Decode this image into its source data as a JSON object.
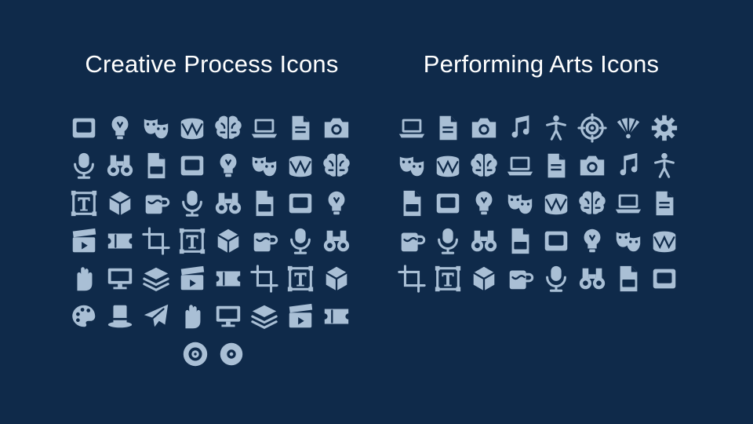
{
  "left_section": {
    "title": "Creative Process Icons"
  },
  "right_section": {
    "title": "Performing Arts Icons"
  },
  "theme": {
    "background": "#0f2a4a",
    "icon_color": "#a9bfd5",
    "title_color": "#ffffff"
  },
  "left_icons": [
    [
      "compass-drawing-icon",
      "color-swatch-icon",
      "cubes-icon",
      "color-wheel-icon",
      "puzzle-icon",
      "eye-frame-icon",
      "design-document-icon",
      "pen-monitor-icon"
    ],
    [
      "pen-tool-icon",
      "text-tool-icon",
      "lightbulb-pen-icon",
      "diamond-icon",
      "video-editor-icon",
      "sound-mixer-icon",
      "head-gear-icon",
      "tablet-design-icon"
    ],
    [
      "ink-bottle-icon",
      "eraser-icon",
      "mug-paint-icon",
      "art-supplies-icon",
      "paper-plane-hand-icon",
      "gear-pen-icon",
      "cactus-pot-icon",
      "desk-lamp-icon"
    ],
    [
      "sketchbook-icon",
      "design-folder-icon",
      "easel-icon",
      "coffee-cup-icon",
      "camera-icon",
      "layers-icon",
      "mouse-icon",
      "devices-icon"
    ],
    [
      "magnifier-design-icon",
      "document-gear-icon",
      "headphones-icon",
      "floppy-disk-icon",
      "highlighter-icon",
      "code-window-icon",
      "psd-file-icon",
      "image-frame-icon"
    ],
    [
      "laptop-design-icon",
      "printer-icon",
      "target-icon",
      "brain-icon",
      "idea-pen-icon",
      "paper-plane-icon",
      "ai-file-icon",
      "3d-cube-icon"
    ],
    [
      "chip-gear-icon",
      "crop-icon"
    ]
  ],
  "right_icons": [
    [
      "theater-masks-icon",
      "palette-icon",
      "lyre-icon",
      "ink-quill-icon",
      "masquerade-mask-icon",
      "hand-fan-icon",
      "flower-bouquet-icon",
      "ballet-shoes-icon"
    ],
    [
      "stage-curtains-icon",
      "typewriter-icon",
      "open-book-board-icon",
      "film-camera-icon",
      "speaker-icon",
      "drum-icon",
      "crossed-sticks-icon",
      "director-chair-icon"
    ],
    [
      "microphone-icon",
      "clapperboard-icon",
      "top-hat-icon",
      "tickets-icon",
      "award-statue-icon",
      "popcorn-icon",
      "megaphone-icon",
      "film-reel-icon"
    ],
    [
      "museum-icon",
      "scroll-icon",
      "framed-painting-icon",
      "music-notes-icon",
      "vinyl-disc-icon",
      "ball-gown-icon",
      "column-icon",
      "waving-hand-icon"
    ],
    [
      "picture-frame-icon",
      "dancer-kick-icon",
      "binoculars-icon",
      "dancer-pose-icon",
      "violin-icon",
      "opera-house-icon",
      "rope-barrier-icon",
      "grand-piano-icon"
    ]
  ]
}
